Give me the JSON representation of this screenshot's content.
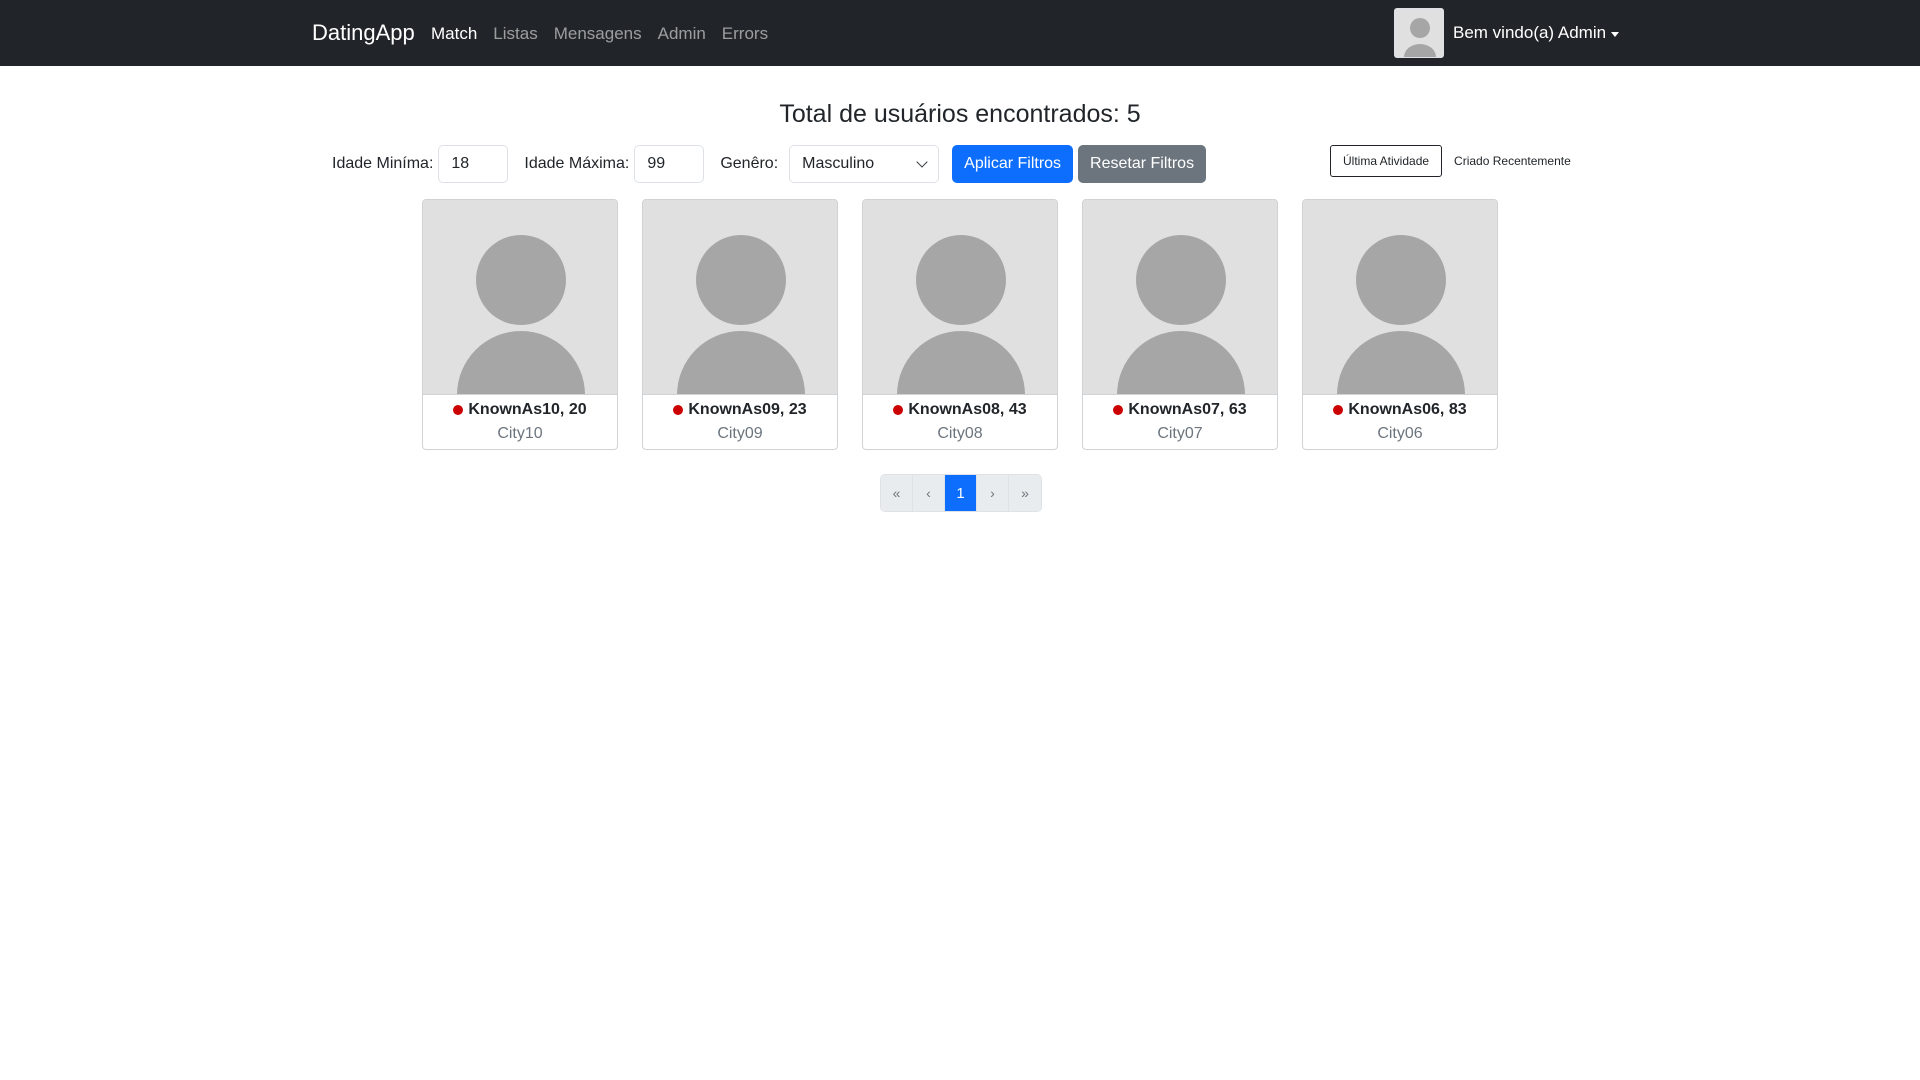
{
  "navbar": {
    "brand": "DatingApp",
    "links": [
      "Match",
      "Listas",
      "Mensagens",
      "Admin",
      "Errors"
    ],
    "welcome": "Bem vindo(a) Admin"
  },
  "title": "Total de usuários encontrados: 5",
  "filters": {
    "min_age_label": "Idade Miníma:",
    "min_age_value": "18",
    "max_age_label": "Idade Máxima:",
    "max_age_value": "99",
    "gender_label": "Genêro:",
    "gender_value": "Masculino",
    "apply_label": "Aplicar Filtros",
    "reset_label": "Resetar Filtros"
  },
  "sort": {
    "last_active": "Última Atividade",
    "newest": "Criado Recentemente"
  },
  "members": [
    {
      "name": "KnownAs10, 20",
      "city": "City10"
    },
    {
      "name": "KnownAs09, 23",
      "city": "City09"
    },
    {
      "name": "KnownAs08, 43",
      "city": "City08"
    },
    {
      "name": "KnownAs07, 63",
      "city": "City07"
    },
    {
      "name": "KnownAs06, 83",
      "city": "City06"
    }
  ],
  "pagination": {
    "first": "«",
    "prev": "‹",
    "current": "1",
    "next": "›",
    "last": "»"
  },
  "colors": {
    "navbar_bg": "#212529",
    "primary": "#0d6efd",
    "secondary": "#6c757d",
    "offline_dot": "#cc0000"
  }
}
